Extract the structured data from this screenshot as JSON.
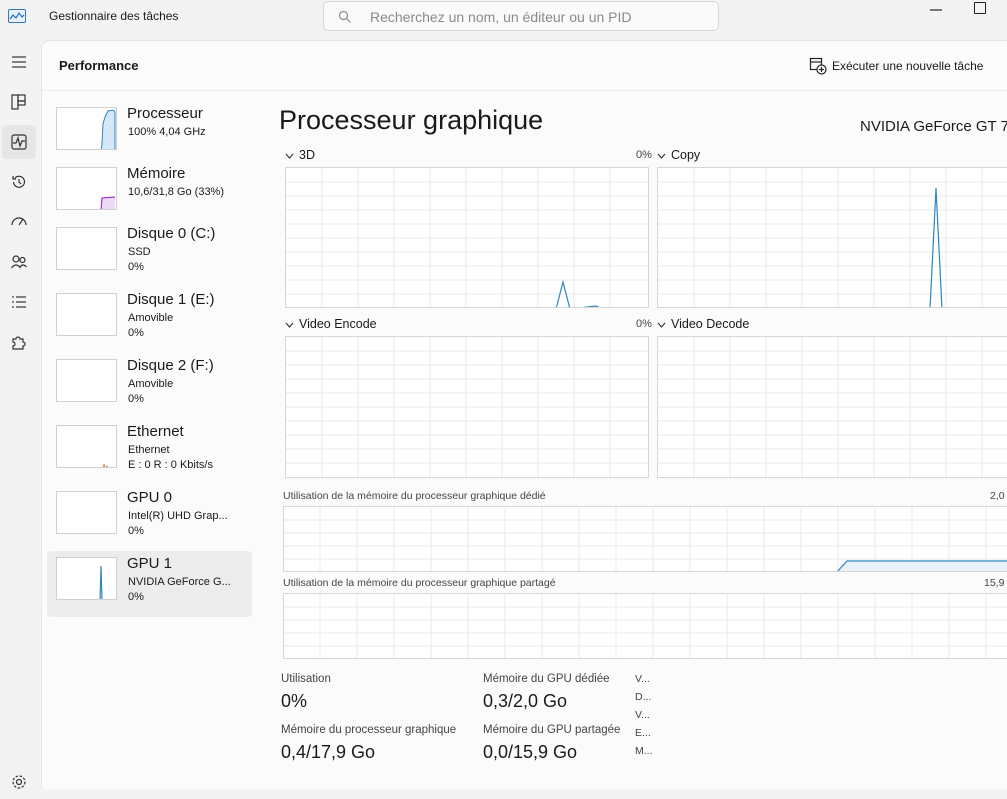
{
  "titlebar": {
    "app_title": "Gestionnaire des tâches",
    "search_placeholder": "Recherchez un nom, un éditeur ou un PID"
  },
  "header": {
    "page_title": "Performance",
    "run_task_label": "Exécuter une nouvelle tâche"
  },
  "devices": [
    {
      "name": "Processeur",
      "line1": "100%  4,04 GHz",
      "line2": "",
      "color": "#2e86c1"
    },
    {
      "name": "Mémoire",
      "line1": "10,6/31,8 Go (33%)",
      "line2": "",
      "color": "#9b34c8"
    },
    {
      "name": "Disque 0 (C:)",
      "line1": "SSD",
      "line2": "0%",
      "color": "#4caf50"
    },
    {
      "name": "Disque 1 (E:)",
      "line1": "Amovible",
      "line2": "0%",
      "color": "#4caf50"
    },
    {
      "name": "Disque 2 (F:)",
      "line1": "Amovible",
      "line2": "0%",
      "color": "#4caf50"
    },
    {
      "name": "Ethernet",
      "line1": "Ethernet",
      "line2": "E : 0  R : 0 Kbits/s",
      "color": "#c98a4b"
    },
    {
      "name": "GPU 0",
      "line1": "Intel(R) UHD Grap...",
      "line2": "0%",
      "color": "#2e86c1"
    },
    {
      "name": "GPU 1",
      "line1": "NVIDIA GeForce G...",
      "line2": "0%",
      "color": "#2e86c1"
    }
  ],
  "detail": {
    "title": "Processeur graphique",
    "gpu_name": "NVIDIA GeForce GT 7",
    "engines": [
      {
        "label": "3D",
        "pct": "0%"
      },
      {
        "label": "Copy",
        "pct": ""
      },
      {
        "label": "Video Encode",
        "pct": "0%"
      },
      {
        "label": "Video Decode",
        "pct": ""
      }
    ],
    "dedicated_label": "Utilisation de la mémoire du processeur graphique dédié",
    "dedicated_max": "2,0",
    "shared_label": "Utilisation de la mémoire du processeur graphique partagé",
    "shared_max": "15,9",
    "stats": {
      "utilisation_label": "Utilisation",
      "utilisation_value": "0%",
      "dedicated_mem_label": "Mémoire du GPU dédiée",
      "dedicated_mem_value": "0,3/2,0 Go",
      "gpu_mem_label": "Mémoire du processeur graphique",
      "gpu_mem_value": "0,4/17,9 Go",
      "shared_mem_label": "Mémoire du GPU partagée",
      "shared_mem_value": "0,0/15,9 Go",
      "truncated": [
        "V...",
        "D...",
        "V...",
        "E...",
        "M..."
      ]
    }
  },
  "colors": {
    "graph_line": "#2e86c1",
    "grid": "#e9e9e9",
    "memory": "#9b34c8"
  }
}
